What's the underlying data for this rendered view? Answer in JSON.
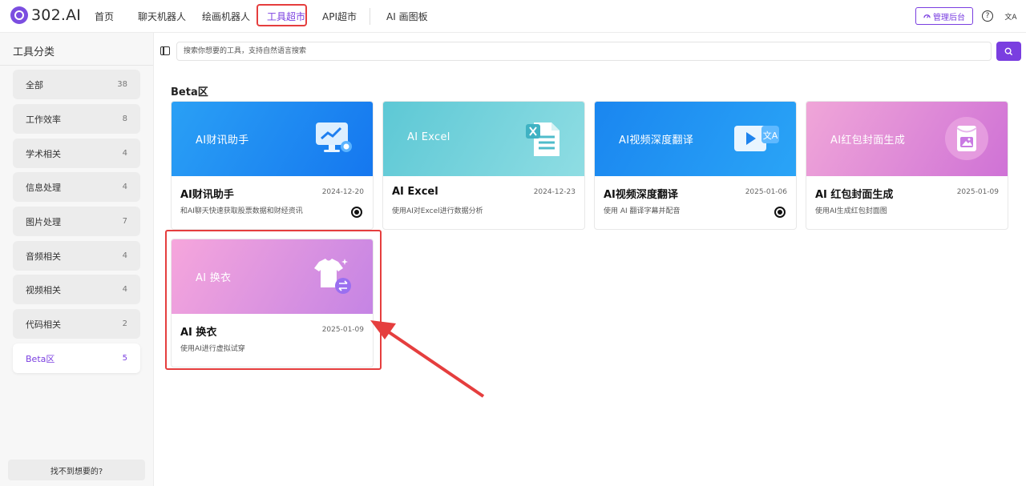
{
  "brand": {
    "logo_text": "302.AI"
  },
  "nav": {
    "items": [
      "首页",
      "聊天机器人",
      "绘画机器人",
      "工具超市",
      "API超市",
      "AI 画图板"
    ],
    "active": "工具超市"
  },
  "header_actions": {
    "admin_label": "管理后台",
    "help_icon": "?",
    "lang_icon": "文A"
  },
  "sidebar": {
    "title": "工具分类",
    "items": [
      {
        "label": "全部",
        "count": "38"
      },
      {
        "label": "工作效率",
        "count": "8"
      },
      {
        "label": "学术相关",
        "count": "4"
      },
      {
        "label": "信息处理",
        "count": "4"
      },
      {
        "label": "图片处理",
        "count": "7"
      },
      {
        "label": "音频相关",
        "count": "4"
      },
      {
        "label": "视频相关",
        "count": "4"
      },
      {
        "label": "代码相关",
        "count": "2"
      },
      {
        "label": "Beta区",
        "count": "5"
      }
    ],
    "active": "Beta区",
    "footer": "找不到想要的?"
  },
  "search": {
    "placeholder": "搜索你想要的工具，支持自然语言搜索"
  },
  "section": {
    "title": "Beta区"
  },
  "cards": [
    {
      "banner_title": "AI财讯助手",
      "name": "AI财讯助手",
      "date": "2024-12-20",
      "desc": "和AI聊天快速获取股票数据和财经资讯",
      "github": true
    },
    {
      "banner_title": "AI Excel",
      "name": "AI Excel",
      "date": "2024-12-23",
      "desc": "使用AI对Excel进行数据分析",
      "github": false
    },
    {
      "banner_title": "AI视频深度翻译",
      "name": "AI视频深度翻译",
      "date": "2025-01-06",
      "desc": "使用 AI 翻译字幕并配音",
      "github": true
    },
    {
      "banner_title": "AI红包封面生成",
      "name": "AI 红包封面生成",
      "date": "2025-01-09",
      "desc": "使用AI生成红包封面图",
      "github": false
    },
    {
      "banner_title": "AI 换衣",
      "name": "AI 换衣",
      "date": "2025-01-09",
      "desc": "使用AI进行虚拟试穿",
      "github": false
    }
  ],
  "colors": {
    "accent": "#7a3ee0",
    "annotation_red": "#e53e3e"
  }
}
